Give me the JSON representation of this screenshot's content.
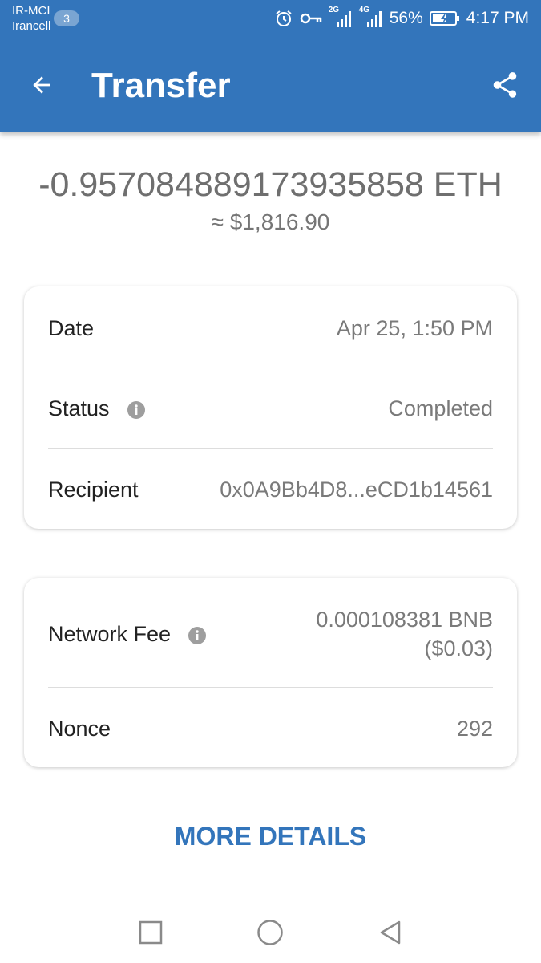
{
  "status_bar": {
    "carrier_1": "IR-MCI",
    "carrier_2": "Irancell",
    "sim_badge": "3",
    "network_1": "2G",
    "network_2": "4G",
    "battery": "56%",
    "time": "4:17 PM"
  },
  "header": {
    "title": "Transfer"
  },
  "summary": {
    "amount": "-0.957084889173935858 ETH",
    "fiat": "≈ $1,816.90"
  },
  "details": {
    "date_label": "Date",
    "date_value": "Apr 25, 1:50 PM",
    "status_label": "Status",
    "status_value": "Completed",
    "recipient_label": "Recipient",
    "recipient_value": "0x0A9Bb4D8...eCD1b14561"
  },
  "fees": {
    "network_fee_label": "Network Fee",
    "network_fee_line1": "0.000108381 BNB",
    "network_fee_line2": "($0.03)",
    "nonce_label": "Nonce",
    "nonce_value": "292"
  },
  "actions": {
    "more_details": "MORE DETAILS"
  },
  "colors": {
    "primary": "#3375bb",
    "text_dark": "#222222",
    "text_muted": "#7a7a7a"
  }
}
